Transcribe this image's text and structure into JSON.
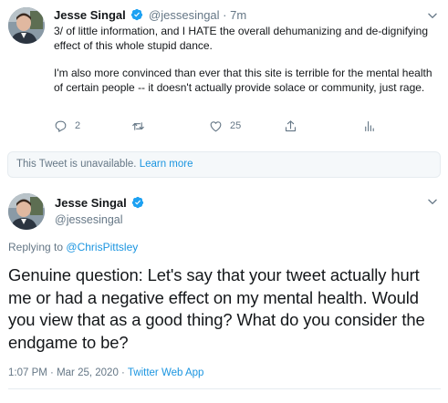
{
  "tweet1": {
    "author_name": "Jesse Singal",
    "handle": "@jessesingal",
    "separator": "·",
    "time": "7m",
    "paragraphs": [
      "3/ of little information, and I HATE the overall dehumanizing and de-dignifying effect of this whole stupid dance.",
      "I'm also more convinced than ever that this site is terrible for the mental health of certain people -- it doesn't actually provide solace or community, just rage."
    ],
    "reply_count": "2",
    "retweet_count": "",
    "like_count": "25",
    "icons": [
      "reply-icon",
      "retweet-icon",
      "like-icon",
      "share-icon",
      "analytics-icon",
      "verified-badge-icon",
      "chevron-down-icon"
    ]
  },
  "unavailable": {
    "text": "This Tweet is unavailable.",
    "link": "Learn more"
  },
  "tweet2": {
    "author_name": "Jesse Singal",
    "handle": "@jessesingal",
    "replying_prefix": "Replying to",
    "replying_to": "@ChrisPittsley",
    "text": "Genuine question: Let's say that your tweet actually hurt me or had a negative effect on my mental health. Would you view that as a good thing? What do you consider the endgame to be?",
    "time": "1:07 PM",
    "date": "Mar 25, 2020",
    "separator": "·",
    "source": "Twitter Web App"
  },
  "colors": {
    "accent": "#1b95e0",
    "muted": "#657786",
    "text": "#14171a",
    "border": "#e6ecf0"
  }
}
